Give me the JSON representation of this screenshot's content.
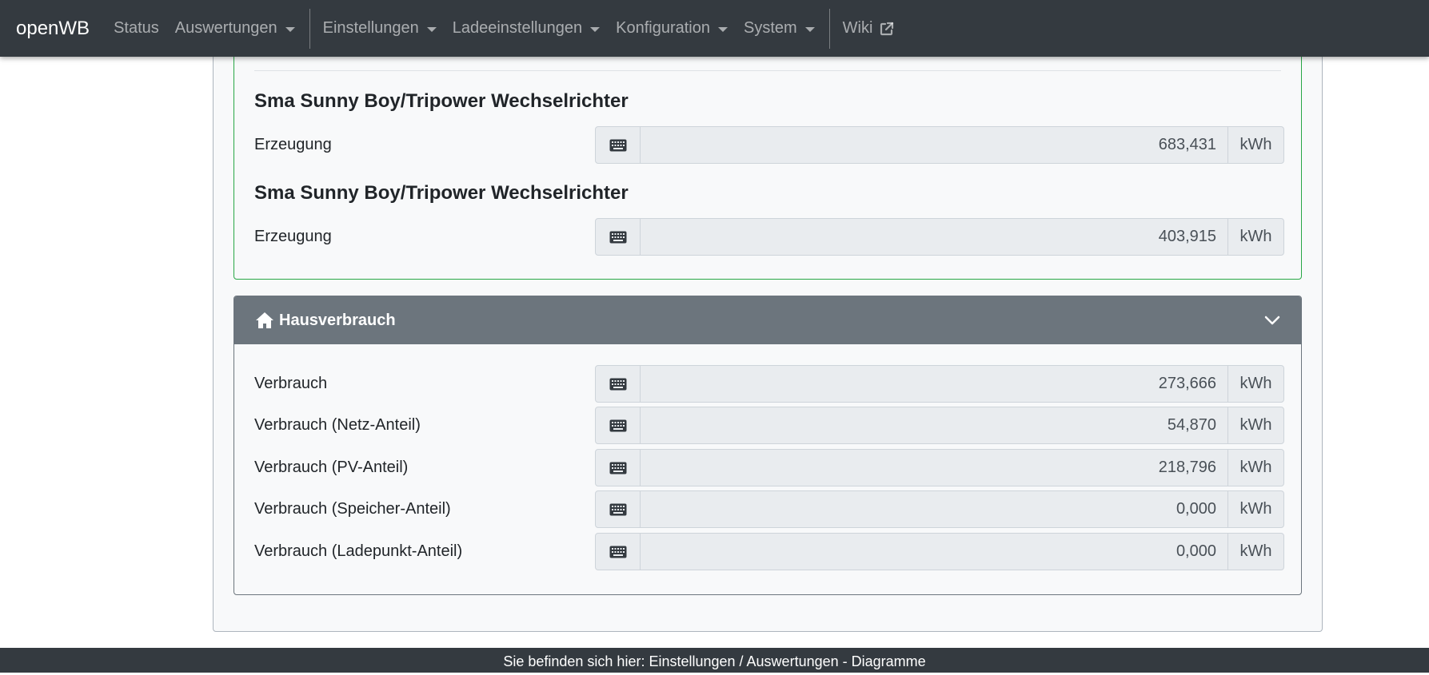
{
  "navbar": {
    "brand": "openWB",
    "items": [
      {
        "label": "Status",
        "dropdown": false
      },
      {
        "label": "Auswertungen",
        "dropdown": true
      },
      {
        "label": "Einstellungen",
        "dropdown": true
      },
      {
        "label": "Ladeeinstellungen",
        "dropdown": true
      },
      {
        "label": "Konfiguration",
        "dropdown": true
      },
      {
        "label": "System",
        "dropdown": true
      },
      {
        "label": "Wiki",
        "dropdown": false
      }
    ]
  },
  "pv": {
    "devices": [
      {
        "title": "Sma Sunny Boy/Tripower Wechselrichter",
        "label": "Erzeugung",
        "value": "683,431",
        "unit": "kWh"
      },
      {
        "title": "Sma Sunny Boy/Tripower Wechselrichter",
        "label": "Erzeugung",
        "value": "403,915",
        "unit": "kWh"
      }
    ]
  },
  "haus": {
    "title": "Hausverbrauch",
    "rows": [
      {
        "label": "Verbrauch",
        "value": "273,666",
        "unit": "kWh"
      },
      {
        "label": "Verbrauch (Netz-Anteil)",
        "value": "54,870",
        "unit": "kWh"
      },
      {
        "label": "Verbrauch (PV-Anteil)",
        "value": "218,796",
        "unit": "kWh"
      },
      {
        "label": "Verbrauch (Speicher-Anteil)",
        "value": "0,000",
        "unit": "kWh"
      },
      {
        "label": "Verbrauch (Ladepunkt-Anteil)",
        "value": "0,000",
        "unit": "kWh"
      }
    ]
  },
  "footer": {
    "text": "Sie befinden sich hier: Einstellungen / Auswertungen - Diagramme"
  },
  "colors": {
    "navbar": "#343a40",
    "pv_border": "#28a745",
    "haus_header": "#6c757d"
  },
  "icons": {
    "input_prepend": "keyboard-icon",
    "haus_header": "home-icon",
    "collapse": "chevron-down-icon",
    "wiki": "external-link-icon"
  }
}
